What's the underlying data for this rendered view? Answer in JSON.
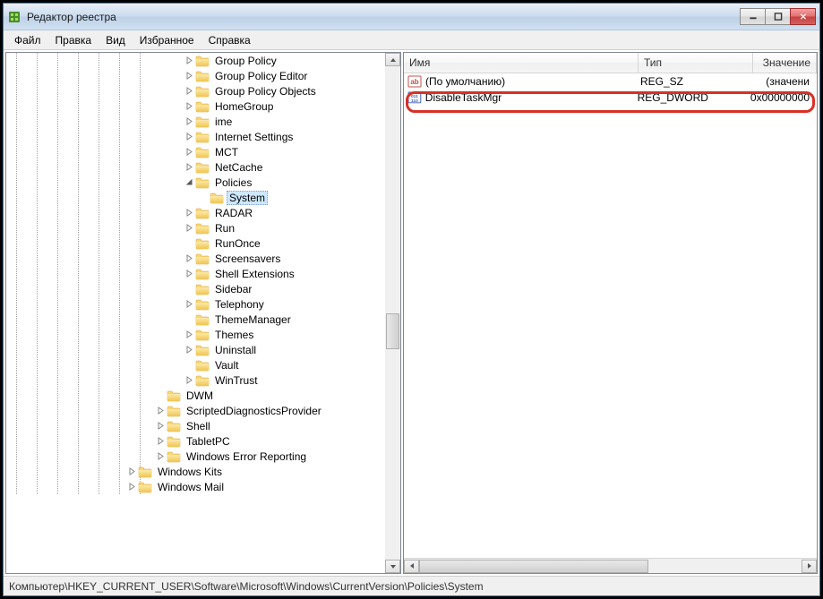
{
  "title": "Редактор реестра",
  "menu": {
    "file": "Файл",
    "edit": "Правка",
    "view": "Вид",
    "favorites": "Избранное",
    "help": "Справка"
  },
  "tree": {
    "items": [
      {
        "label": "Group Policy",
        "depth": 0,
        "expander": "closed"
      },
      {
        "label": "Group Policy Editor",
        "depth": 0,
        "expander": "closed"
      },
      {
        "label": "Group Policy Objects",
        "depth": 0,
        "expander": "closed"
      },
      {
        "label": "HomeGroup",
        "depth": 0,
        "expander": "closed"
      },
      {
        "label": "ime",
        "depth": 0,
        "expander": "closed"
      },
      {
        "label": "Internet Settings",
        "depth": 0,
        "expander": "closed"
      },
      {
        "label": "MCT",
        "depth": 0,
        "expander": "closed"
      },
      {
        "label": "NetCache",
        "depth": 0,
        "expander": "closed"
      },
      {
        "label": "Policies",
        "depth": 0,
        "expander": "open"
      },
      {
        "label": "System",
        "depth": 1,
        "expander": "none",
        "selected": true
      },
      {
        "label": "RADAR",
        "depth": 0,
        "expander": "closed"
      },
      {
        "label": "Run",
        "depth": 0,
        "expander": "closed"
      },
      {
        "label": "RunOnce",
        "depth": 0,
        "expander": "none"
      },
      {
        "label": "Screensavers",
        "depth": 0,
        "expander": "closed"
      },
      {
        "label": "Shell Extensions",
        "depth": 0,
        "expander": "closed"
      },
      {
        "label": "Sidebar",
        "depth": 0,
        "expander": "none"
      },
      {
        "label": "Telephony",
        "depth": 0,
        "expander": "closed"
      },
      {
        "label": "ThemeManager",
        "depth": 0,
        "expander": "none"
      },
      {
        "label": "Themes",
        "depth": 0,
        "expander": "closed"
      },
      {
        "label": "Uninstall",
        "depth": 0,
        "expander": "closed"
      },
      {
        "label": "Vault",
        "depth": 0,
        "expander": "none"
      },
      {
        "label": "WinTrust",
        "depth": 0,
        "expander": "closed"
      },
      {
        "label": "DWM",
        "depth": -1,
        "expander": "none"
      },
      {
        "label": "ScriptedDiagnosticsProvider",
        "depth": -1,
        "expander": "closed"
      },
      {
        "label": "Shell",
        "depth": -1,
        "expander": "closed"
      },
      {
        "label": "TabletPC",
        "depth": -1,
        "expander": "closed"
      },
      {
        "label": "Windows Error Reporting",
        "depth": -1,
        "expander": "closed"
      },
      {
        "label": "Windows Kits",
        "depth": -2,
        "expander": "closed"
      },
      {
        "label": "Windows Mail",
        "depth": -2,
        "expander": "closed"
      }
    ]
  },
  "list": {
    "columns": {
      "name": "Имя",
      "type": "Тип",
      "value": "Значение"
    },
    "rows": [
      {
        "icon": "string",
        "name": "(По умолчанию)",
        "type": "REG_SZ",
        "value": "(значени"
      },
      {
        "icon": "dword",
        "name": "DisableTaskMgr",
        "type": "REG_DWORD",
        "value": "0x00000000"
      }
    ]
  },
  "statusbar": {
    "path": "Компьютер\\HKEY_CURRENT_USER\\Software\\Microsoft\\Windows\\CurrentVersion\\Policies\\System"
  }
}
